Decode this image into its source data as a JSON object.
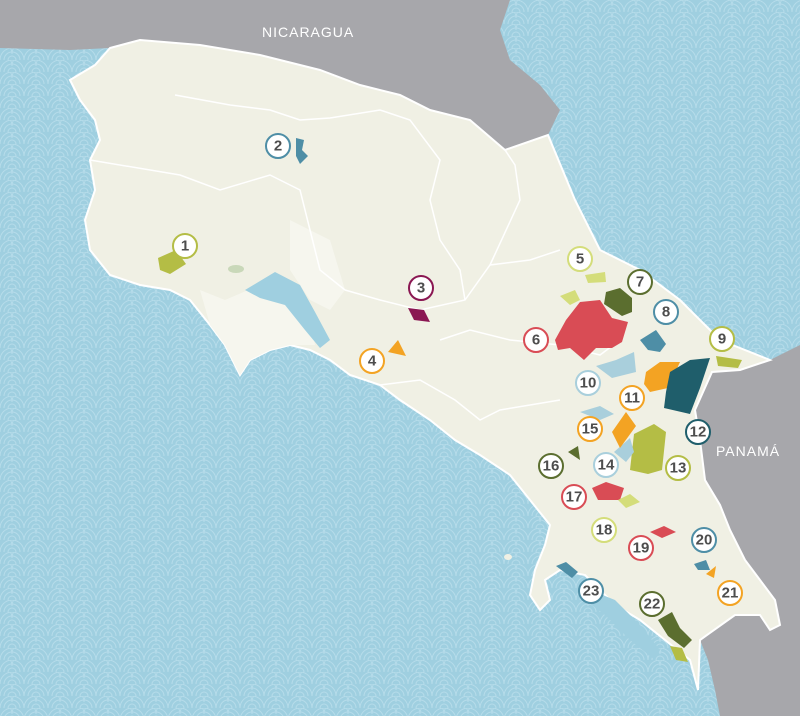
{
  "countries": {
    "north": "NICARAGUA",
    "south": "PANAMÁ"
  },
  "colors": {
    "sea": "#9fcfe0",
    "sea_pattern": "#b6dcea",
    "land": "#f0f0e4",
    "land_light": "#f6f6ee",
    "border": "#ffffff",
    "neighbor": "#a7a7ab",
    "red": "#d94c55",
    "olive": "#5b6e2f",
    "lime": "#b4bd45",
    "steel": "#4e8ea6",
    "orange": "#f3a323",
    "teal": "#1f5e6b",
    "purple": "#8a1752",
    "pale_lime": "#d4dd7a",
    "pale_blue": "#a9cfdc"
  },
  "markers": [
    {
      "label": "1",
      "color": "#b4bd45"
    },
    {
      "label": "2",
      "color": "#4e8ea6"
    },
    {
      "label": "3",
      "color": "#8a1752"
    },
    {
      "label": "4",
      "color": "#f3a323"
    },
    {
      "label": "5",
      "color": "#d4dd7a"
    },
    {
      "label": "6",
      "color": "#d94c55"
    },
    {
      "label": "7",
      "color": "#5b6e2f"
    },
    {
      "label": "8",
      "color": "#4e8ea6"
    },
    {
      "label": "9",
      "color": "#b4bd45"
    },
    {
      "label": "10",
      "color": "#a9cfdc"
    },
    {
      "label": "11",
      "color": "#f3a323"
    },
    {
      "label": "12",
      "color": "#1f5e6b"
    },
    {
      "label": "13",
      "color": "#b4bd45"
    },
    {
      "label": "14",
      "color": "#a9cfdc"
    },
    {
      "label": "15",
      "color": "#f3a323"
    },
    {
      "label": "16",
      "color": "#5b6e2f"
    },
    {
      "label": "17",
      "color": "#d94c55"
    },
    {
      "label": "18",
      "color": "#d4dd7a"
    },
    {
      "label": "19",
      "color": "#d94c55"
    },
    {
      "label": "20",
      "color": "#4e8ea6"
    },
    {
      "label": "21",
      "color": "#f3a323"
    },
    {
      "label": "22",
      "color": "#5b6e2f"
    },
    {
      "label": "23",
      "color": "#4e8ea6"
    }
  ]
}
